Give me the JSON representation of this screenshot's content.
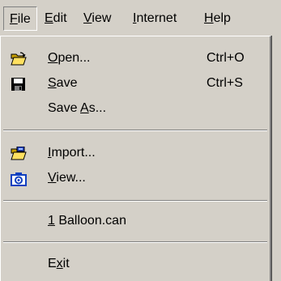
{
  "menubar": {
    "items": [
      {
        "pre": "",
        "ul": "F",
        "post": "ile"
      },
      {
        "pre": "",
        "ul": "E",
        "post": "dit"
      },
      {
        "pre": "",
        "ul": "V",
        "post": "iew"
      },
      {
        "pre": "",
        "ul": "I",
        "post": "nternet"
      },
      {
        "pre": "",
        "ul": "H",
        "post": "elp"
      }
    ]
  },
  "file_menu": {
    "open": {
      "pre": "",
      "ul": "O",
      "post": "pen...",
      "shortcut": "Ctrl+O",
      "icon": "open-folder-icon"
    },
    "save": {
      "pre": "",
      "ul": "S",
      "post": "ave",
      "shortcut": "Ctrl+S",
      "icon": "floppy-disk-icon"
    },
    "save_as": {
      "pre": "Save ",
      "ul": "A",
      "post": "s..."
    },
    "import": {
      "pre": "",
      "ul": "I",
      "post": "mport...",
      "icon": "import-folder-icon"
    },
    "view": {
      "pre": "",
      "ul": "V",
      "post": "iew...",
      "icon": "camera-icon"
    },
    "recent": [
      {
        "pre": "",
        "ul": "1",
        "post": " Balloon.can"
      }
    ],
    "exit": {
      "pre": "E",
      "ul": "x",
      "post": "it"
    }
  }
}
